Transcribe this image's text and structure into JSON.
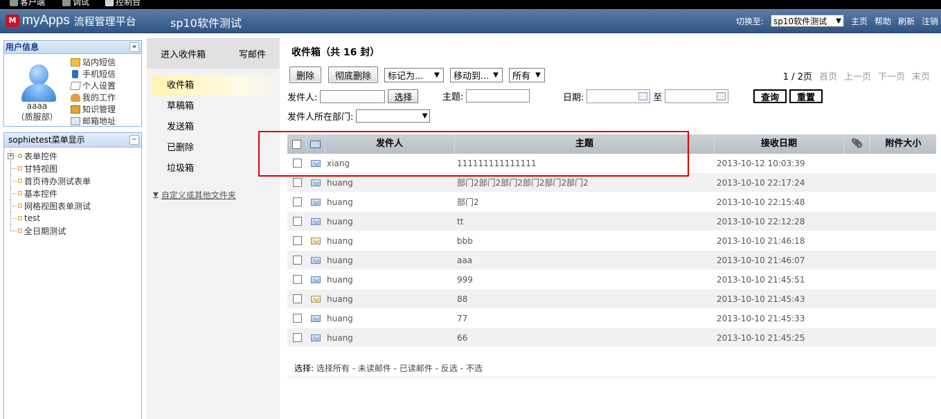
{
  "topbar": {
    "items": [
      {
        "label": "客户端",
        "icon": "gear-icon"
      },
      {
        "label": "调试",
        "icon": "gear-icon"
      },
      {
        "label": "控制台",
        "icon": "monitor-icon"
      }
    ]
  },
  "header": {
    "logo_mark": "M",
    "brand": "myApps",
    "brand_sub": "流程管理平台",
    "app_name": "sp10软件测试",
    "switch_label": "切换至:",
    "switch_value": "sp10软件测试",
    "links": [
      "主页",
      "帮助",
      "刷新",
      "注销"
    ]
  },
  "user_panel": {
    "title": "用户信息",
    "collapse": "«",
    "name": "aaaa",
    "dept": "（质服部）",
    "links": [
      {
        "label": "站内短信",
        "icon": "mail-icon"
      },
      {
        "label": "手机短信",
        "icon": "phone-icon"
      },
      {
        "label": "个人设置",
        "icon": "edit-icon"
      },
      {
        "label": "我的工作",
        "icon": "work-icon"
      },
      {
        "label": "知识管理",
        "icon": "book-icon"
      },
      {
        "label": "邮箱地址",
        "icon": "address-icon"
      }
    ]
  },
  "menu_panel": {
    "title": "sophietest菜单显示",
    "collapse": "−",
    "items": [
      {
        "label": "表单控件",
        "expandable": true
      },
      {
        "label": "甘特视图",
        "expandable": false
      },
      {
        "label": "首页待办测试表单",
        "expandable": false
      },
      {
        "label": "基本控件",
        "expandable": false
      },
      {
        "label": "网格视图表单测试",
        "expandable": false
      },
      {
        "label": "test",
        "expandable": false
      },
      {
        "label": "全日期测试",
        "expandable": false
      }
    ]
  },
  "mail_nav": {
    "enter_inbox": "进入收件箱",
    "compose": "写邮件",
    "folders": [
      "收件箱",
      "草稿箱",
      "发送箱",
      "已删除",
      "垃圾箱"
    ],
    "active_folder": 0,
    "custom": "自定义或其他文件夹"
  },
  "inbox": {
    "title": "收件箱（共 16 封）",
    "toolbar": {
      "delete": "删除",
      "purge": "彻底删除",
      "mark_as": "标记为...",
      "move_to": "移动到...",
      "filter": "所有"
    },
    "pager": {
      "current": "1 / 2页",
      "first": "首页",
      "prev": "上一页",
      "next": "下一页",
      "last": "末页"
    },
    "filters": {
      "sender_label": "发件人:",
      "select_btn": "选择",
      "subject_label": "主题:",
      "date_label": "日期:",
      "to_label": "至",
      "query_btn": "查询",
      "reset_btn": "重置",
      "dept_label": "发件人所在部门:"
    },
    "columns": {
      "from": "发件人",
      "subject": "主题",
      "date": "接收日期",
      "size": "附件大小"
    },
    "rows": [
      {
        "from": "xiang",
        "subject": "111111111111111",
        "date": "2013-10-12 10:03:39",
        "read": false
      },
      {
        "from": "huang",
        "subject": "部门2部门2部门2部门2部门2部门2",
        "date": "2013-10-10 22:17:24",
        "read": false
      },
      {
        "from": "huang",
        "subject": "部门2",
        "date": "2013-10-10 22:15:48",
        "read": false
      },
      {
        "from": "huang",
        "subject": "tt",
        "date": "2013-10-10 22:12:28",
        "read": false
      },
      {
        "from": "huang",
        "subject": "bbb",
        "date": "2013-10-10 21:46:18",
        "read": true
      },
      {
        "from": "huang",
        "subject": "aaa",
        "date": "2013-10-10 21:46:07",
        "read": false
      },
      {
        "from": "huang",
        "subject": "999",
        "date": "2013-10-10 21:45:51",
        "read": false
      },
      {
        "from": "huang",
        "subject": "88",
        "date": "2013-10-10 21:45:43",
        "read": true
      },
      {
        "from": "huang",
        "subject": "77",
        "date": "2013-10-10 21:45:33",
        "read": false
      },
      {
        "from": "huang",
        "subject": "66",
        "date": "2013-10-10 21:45:25",
        "read": false
      }
    ],
    "select_label": "选择:",
    "select_options": "选择所有 - 未读邮件 - 已读邮件 - 反选 - 不选"
  },
  "colors": {
    "header_top": "#5a7ca5",
    "header_bottom": "#2f5587",
    "panel_border": "#8db2e3",
    "highlight": "#e00000"
  }
}
